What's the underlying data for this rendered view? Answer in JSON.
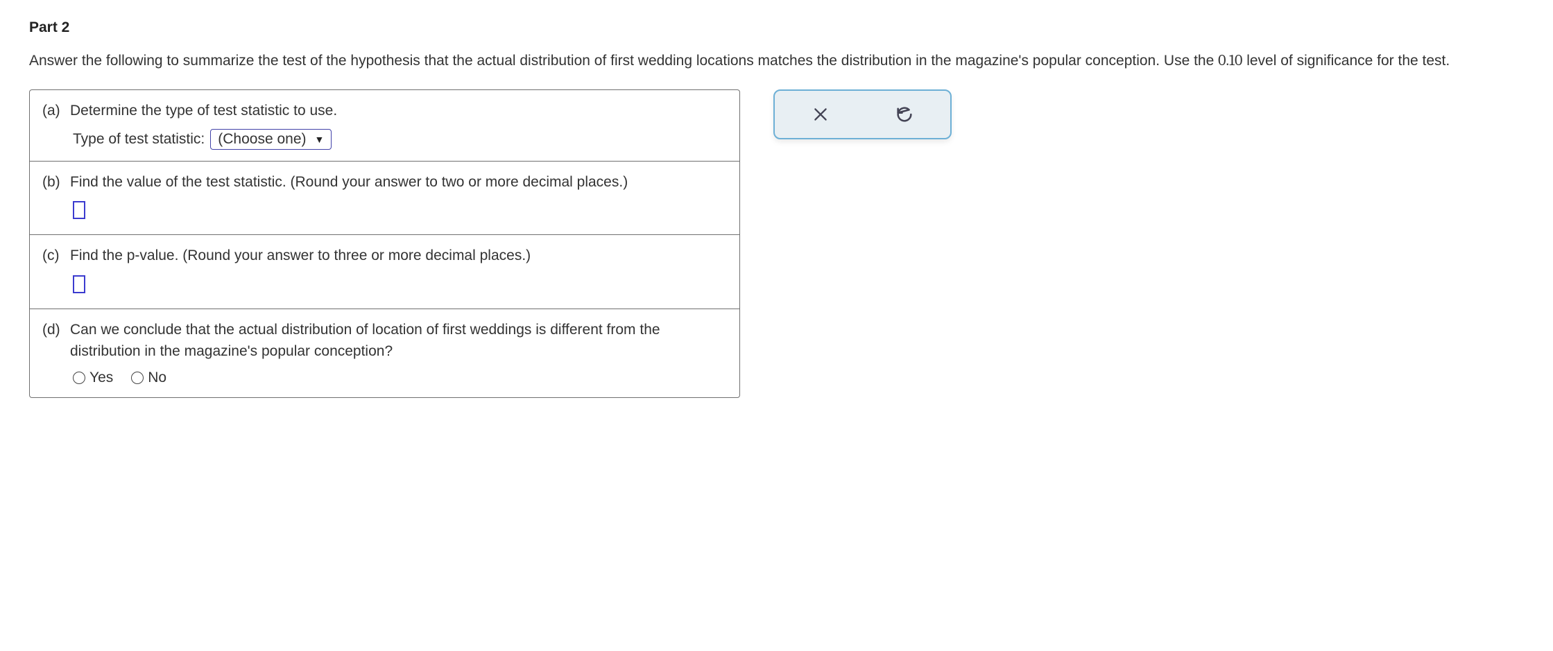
{
  "header": {
    "part_title": "Part 2",
    "instructions_pre": "Answer the following to summarize the test of the hypothesis that the actual distribution of first wedding locations matches the distribution in the magazine's popular conception. Use the ",
    "significance_level": "0.10",
    "instructions_post": " level of significance for the test."
  },
  "questions": {
    "a": {
      "label": "(a)",
      "text": "Determine the type of test statistic to use.",
      "sub_label": "Type of test statistic:",
      "select_placeholder": "(Choose one)"
    },
    "b": {
      "label": "(b)",
      "text": "Find the value of the test statistic. (Round your answer to two or more decimal places.)"
    },
    "c": {
      "label": "(c)",
      "text": "Find the p-value. (Round your answer to three or more decimal places.)"
    },
    "d": {
      "label": "(d)",
      "text": "Can we conclude that the actual distribution of location of first weddings is different from the distribution in the magazine's popular conception?",
      "options": {
        "yes": "Yes",
        "no": "No"
      }
    }
  },
  "toolbar": {
    "clear": "clear",
    "reset": "reset"
  }
}
